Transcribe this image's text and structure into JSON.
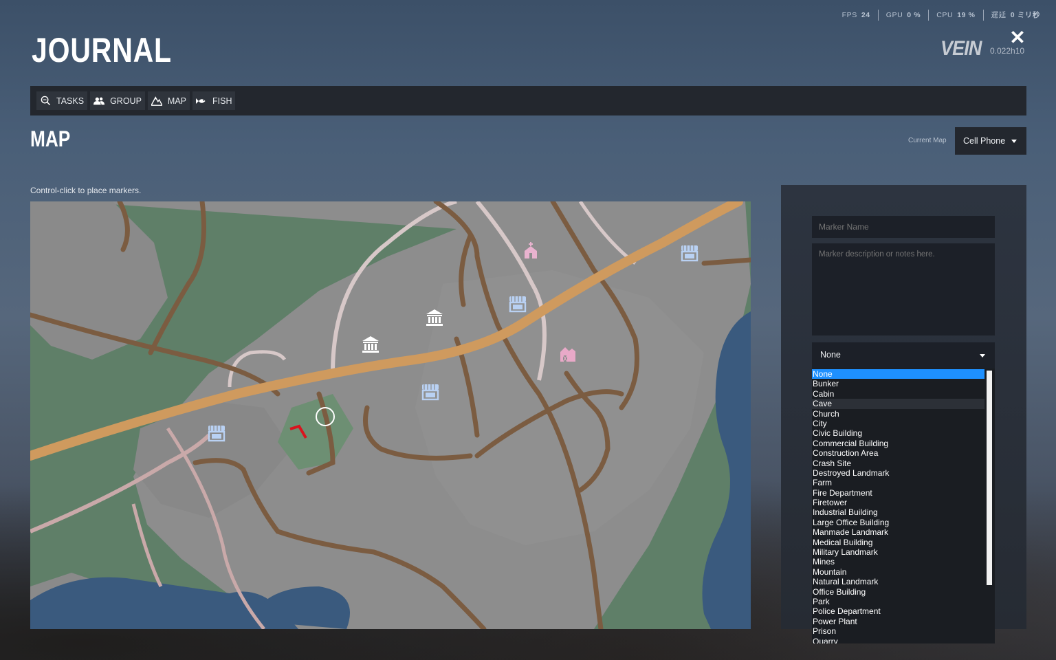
{
  "perf": {
    "fps_label": "FPS",
    "fps_value": "24",
    "gpu_label": "GPU",
    "gpu_value": "0 %",
    "cpu_label": "CPU",
    "cpu_value": "19 %",
    "latency_label": "遅延",
    "latency_value": "0 ミリ秒"
  },
  "header": {
    "title": "JOURNAL",
    "logo": "VEIN",
    "version": "0.022h10"
  },
  "tabs": [
    {
      "label": "TASKS",
      "icon": "search-icon"
    },
    {
      "label": "GROUP",
      "icon": "group-icon"
    },
    {
      "label": "MAP",
      "icon": "mountain-icon"
    },
    {
      "label": "FISH",
      "icon": "fish-icon"
    }
  ],
  "section": {
    "title": "MAP",
    "hint": "Control-click to place markers."
  },
  "current_map": {
    "label": "Current Map",
    "value": "Cell Phone"
  },
  "marker_form": {
    "name_placeholder": "Marker Name",
    "description_placeholder": "Marker description or notes here.",
    "type_value": "None",
    "type_options": [
      "None",
      "Bunker",
      "Cabin",
      "Cave",
      "Church",
      "City",
      "Civic Building",
      "Commercial Building",
      "Construction Area",
      "Crash Site",
      "Destroyed Landmark",
      "Farm",
      "Fire Department",
      "Firetower",
      "Industrial Building",
      "Large Office Building",
      "Manmade Landmark",
      "Medical Building",
      "Military Landmark",
      "Mines",
      "Mountain",
      "Natural Landmark",
      "Office Building",
      "Park",
      "Police Department",
      "Power Plant",
      "Prison",
      "Quarry"
    ],
    "selected_option": "None",
    "hovered_option": "Cave"
  },
  "map_markers": [
    {
      "icon": "church-icon",
      "color": "#e9b3cf"
    },
    {
      "icon": "shop-icon",
      "color": "#b9d1f3"
    },
    {
      "icon": "shop-icon",
      "color": "#b9d1f3"
    },
    {
      "icon": "civic-building-icon",
      "color": "#ffffff"
    },
    {
      "icon": "civic-building-icon",
      "color": "#ffffff"
    },
    {
      "icon": "farm-icon",
      "color": "#e9a9c8"
    },
    {
      "icon": "shop-icon",
      "color": "#b9d1f3"
    },
    {
      "icon": "shop-icon",
      "color": "#b9d1f3"
    },
    {
      "icon": "player-position-icon",
      "color": "#ffffff"
    },
    {
      "icon": "player-direction-icon",
      "color": "#d9141e"
    }
  ],
  "colors": {
    "map_ground": "#8a8a8a",
    "map_grass": "#5f7f68",
    "map_water": "#3a5a7e",
    "dirt_road": "#7b5c41",
    "highway": "#cf9a5e",
    "path": "#c9a9a9",
    "selected_option": "#1e90ff"
  }
}
